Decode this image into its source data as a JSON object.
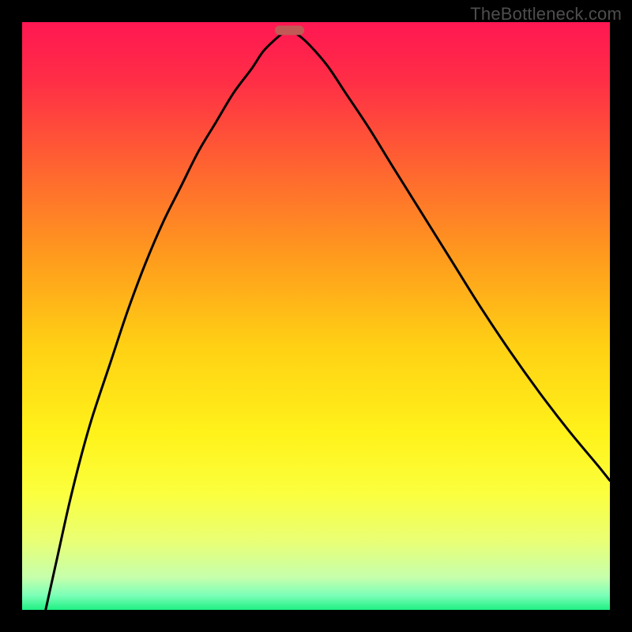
{
  "watermark": "TheBottleneck.com",
  "chart_data": {
    "type": "line",
    "title": "",
    "xlabel": "",
    "ylabel": "",
    "xlim": [
      0,
      100
    ],
    "ylim": [
      0,
      100
    ],
    "gradient_stops": [
      {
        "offset": 0,
        "color": "#ff1752"
      },
      {
        "offset": 0.1,
        "color": "#ff2e46"
      },
      {
        "offset": 0.25,
        "color": "#ff6530"
      },
      {
        "offset": 0.4,
        "color": "#ff9b1d"
      },
      {
        "offset": 0.55,
        "color": "#ffd014"
      },
      {
        "offset": 0.7,
        "color": "#fff21a"
      },
      {
        "offset": 0.8,
        "color": "#fbff3d"
      },
      {
        "offset": 0.88,
        "color": "#eaff72"
      },
      {
        "offset": 0.945,
        "color": "#c6ffac"
      },
      {
        "offset": 0.975,
        "color": "#7dffb8"
      },
      {
        "offset": 1.0,
        "color": "#1ef083"
      }
    ],
    "marker": {
      "x": 45.5,
      "y": 98.6,
      "width": 5.0,
      "height": 1.6,
      "rx": 0.8,
      "color": "#c15a56"
    },
    "series": [
      {
        "name": "left-branch",
        "x": [
          4,
          6,
          8,
          10,
          12,
          15,
          18,
          21,
          24,
          27,
          30,
          33,
          36,
          39,
          41,
          43,
          44.5,
          45.5
        ],
        "y": [
          0,
          9,
          18,
          26,
          33,
          42,
          51,
          59,
          66,
          72,
          78,
          83,
          88,
          92,
          95,
          97,
          98.2,
          98.6
        ]
      },
      {
        "name": "right-branch",
        "x": [
          45.5,
          47,
          49,
          52,
          55,
          59,
          63,
          68,
          73,
          78,
          83,
          88,
          93,
          98,
          100
        ],
        "y": [
          98.6,
          97.8,
          96.0,
          92.5,
          88.0,
          82.0,
          75.5,
          67.5,
          59.5,
          51.5,
          44.0,
          37.0,
          30.5,
          24.5,
          22.0
        ]
      }
    ]
  }
}
